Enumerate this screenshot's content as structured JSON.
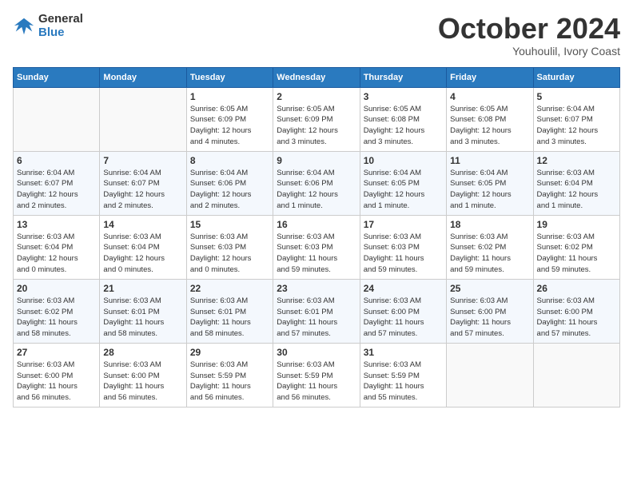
{
  "header": {
    "logo_line1": "General",
    "logo_line2": "Blue",
    "month": "October 2024",
    "location": "Youhoulil, Ivory Coast"
  },
  "weekdays": [
    "Sunday",
    "Monday",
    "Tuesday",
    "Wednesday",
    "Thursday",
    "Friday",
    "Saturday"
  ],
  "weeks": [
    [
      {
        "day": "",
        "info": ""
      },
      {
        "day": "",
        "info": ""
      },
      {
        "day": "1",
        "info": "Sunrise: 6:05 AM\nSunset: 6:09 PM\nDaylight: 12 hours\nand 4 minutes."
      },
      {
        "day": "2",
        "info": "Sunrise: 6:05 AM\nSunset: 6:09 PM\nDaylight: 12 hours\nand 3 minutes."
      },
      {
        "day": "3",
        "info": "Sunrise: 6:05 AM\nSunset: 6:08 PM\nDaylight: 12 hours\nand 3 minutes."
      },
      {
        "day": "4",
        "info": "Sunrise: 6:05 AM\nSunset: 6:08 PM\nDaylight: 12 hours\nand 3 minutes."
      },
      {
        "day": "5",
        "info": "Sunrise: 6:04 AM\nSunset: 6:07 PM\nDaylight: 12 hours\nand 3 minutes."
      }
    ],
    [
      {
        "day": "6",
        "info": "Sunrise: 6:04 AM\nSunset: 6:07 PM\nDaylight: 12 hours\nand 2 minutes."
      },
      {
        "day": "7",
        "info": "Sunrise: 6:04 AM\nSunset: 6:07 PM\nDaylight: 12 hours\nand 2 minutes."
      },
      {
        "day": "8",
        "info": "Sunrise: 6:04 AM\nSunset: 6:06 PM\nDaylight: 12 hours\nand 2 minutes."
      },
      {
        "day": "9",
        "info": "Sunrise: 6:04 AM\nSunset: 6:06 PM\nDaylight: 12 hours\nand 1 minute."
      },
      {
        "day": "10",
        "info": "Sunrise: 6:04 AM\nSunset: 6:05 PM\nDaylight: 12 hours\nand 1 minute."
      },
      {
        "day": "11",
        "info": "Sunrise: 6:04 AM\nSunset: 6:05 PM\nDaylight: 12 hours\nand 1 minute."
      },
      {
        "day": "12",
        "info": "Sunrise: 6:03 AM\nSunset: 6:04 PM\nDaylight: 12 hours\nand 1 minute."
      }
    ],
    [
      {
        "day": "13",
        "info": "Sunrise: 6:03 AM\nSunset: 6:04 PM\nDaylight: 12 hours\nand 0 minutes."
      },
      {
        "day": "14",
        "info": "Sunrise: 6:03 AM\nSunset: 6:04 PM\nDaylight: 12 hours\nand 0 minutes."
      },
      {
        "day": "15",
        "info": "Sunrise: 6:03 AM\nSunset: 6:03 PM\nDaylight: 12 hours\nand 0 minutes."
      },
      {
        "day": "16",
        "info": "Sunrise: 6:03 AM\nSunset: 6:03 PM\nDaylight: 11 hours\nand 59 minutes."
      },
      {
        "day": "17",
        "info": "Sunrise: 6:03 AM\nSunset: 6:03 PM\nDaylight: 11 hours\nand 59 minutes."
      },
      {
        "day": "18",
        "info": "Sunrise: 6:03 AM\nSunset: 6:02 PM\nDaylight: 11 hours\nand 59 minutes."
      },
      {
        "day": "19",
        "info": "Sunrise: 6:03 AM\nSunset: 6:02 PM\nDaylight: 11 hours\nand 59 minutes."
      }
    ],
    [
      {
        "day": "20",
        "info": "Sunrise: 6:03 AM\nSunset: 6:02 PM\nDaylight: 11 hours\nand 58 minutes."
      },
      {
        "day": "21",
        "info": "Sunrise: 6:03 AM\nSunset: 6:01 PM\nDaylight: 11 hours\nand 58 minutes."
      },
      {
        "day": "22",
        "info": "Sunrise: 6:03 AM\nSunset: 6:01 PM\nDaylight: 11 hours\nand 58 minutes."
      },
      {
        "day": "23",
        "info": "Sunrise: 6:03 AM\nSunset: 6:01 PM\nDaylight: 11 hours\nand 57 minutes."
      },
      {
        "day": "24",
        "info": "Sunrise: 6:03 AM\nSunset: 6:00 PM\nDaylight: 11 hours\nand 57 minutes."
      },
      {
        "day": "25",
        "info": "Sunrise: 6:03 AM\nSunset: 6:00 PM\nDaylight: 11 hours\nand 57 minutes."
      },
      {
        "day": "26",
        "info": "Sunrise: 6:03 AM\nSunset: 6:00 PM\nDaylight: 11 hours\nand 57 minutes."
      }
    ],
    [
      {
        "day": "27",
        "info": "Sunrise: 6:03 AM\nSunset: 6:00 PM\nDaylight: 11 hours\nand 56 minutes."
      },
      {
        "day": "28",
        "info": "Sunrise: 6:03 AM\nSunset: 6:00 PM\nDaylight: 11 hours\nand 56 minutes."
      },
      {
        "day": "29",
        "info": "Sunrise: 6:03 AM\nSunset: 5:59 PM\nDaylight: 11 hours\nand 56 minutes."
      },
      {
        "day": "30",
        "info": "Sunrise: 6:03 AM\nSunset: 5:59 PM\nDaylight: 11 hours\nand 56 minutes."
      },
      {
        "day": "31",
        "info": "Sunrise: 6:03 AM\nSunset: 5:59 PM\nDaylight: 11 hours\nand 55 minutes."
      },
      {
        "day": "",
        "info": ""
      },
      {
        "day": "",
        "info": ""
      }
    ]
  ]
}
